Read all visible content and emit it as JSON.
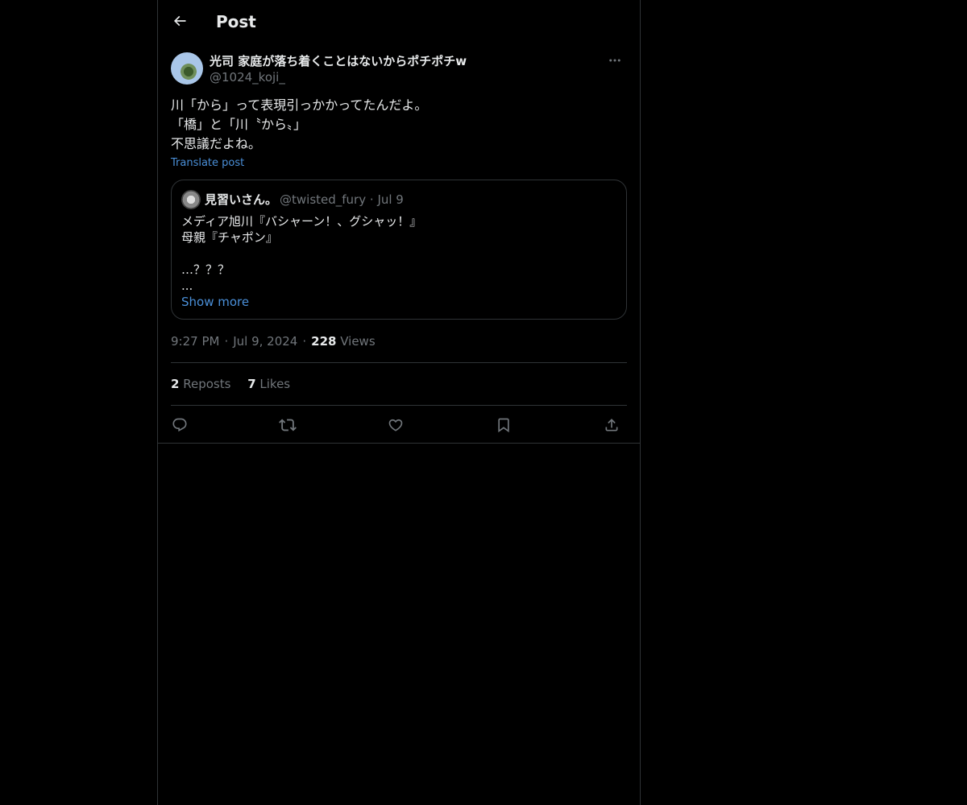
{
  "header": {
    "title": "Post"
  },
  "post": {
    "author_name": "光司 家庭が落ち着くことはないからポチポチw",
    "author_handle": "@1024_koji_",
    "text_lines": [
      "川「から」って表現引っかかってたんだよ。",
      "「橋」と「川〝から〟」",
      "不思議だよね。"
    ],
    "translate_label": "Translate post",
    "time": "9:27 PM",
    "date": "Jul 9, 2024",
    "views_count": "228",
    "views_label": "Views",
    "reposts_count": "2",
    "reposts_label": "Reposts",
    "likes_count": "7",
    "likes_label": "Likes"
  },
  "quote": {
    "author_name": "見習いさん。",
    "author_handle": "@twisted_fury",
    "date": "Jul 9",
    "text_lines": [
      "メディア旭川『バシャーン！、グシャッ！』",
      "母親『チャポン』",
      "",
      "…？？？",
      "..."
    ],
    "show_more_label": "Show more"
  },
  "icons": {
    "back": "arrow-left-icon",
    "more": "more-horizontal-icon",
    "reply": "reply-icon",
    "repost": "repost-icon",
    "like": "heart-icon",
    "bookmark": "bookmark-icon",
    "share": "share-icon"
  },
  "colors": {
    "background": "#000000",
    "text": "#e7e9ea",
    "secondary": "#71767b",
    "border": "#2f3336",
    "link": "#4a8fd8"
  }
}
